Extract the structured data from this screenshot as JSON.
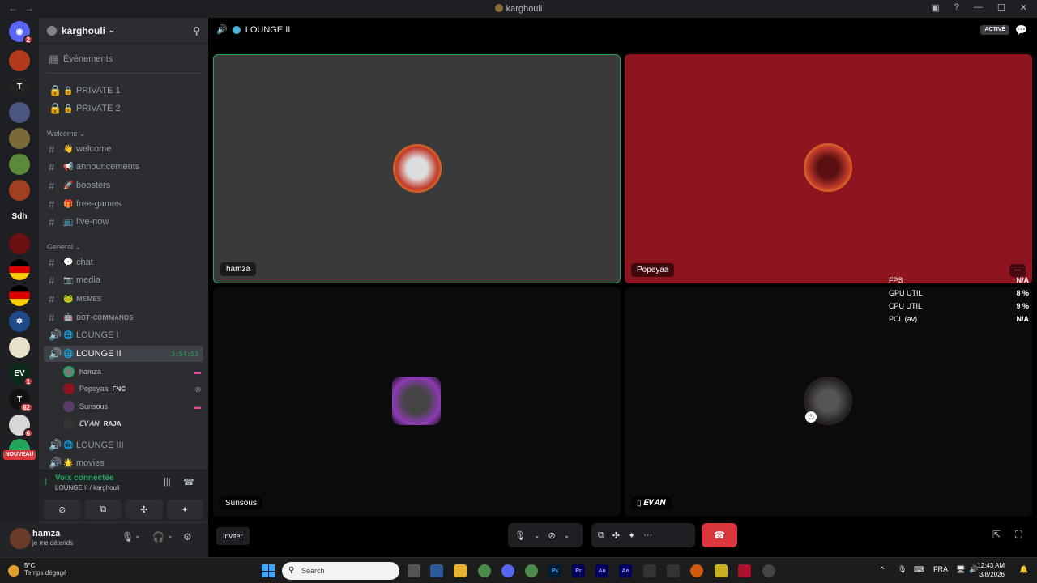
{
  "window": {
    "title": "karghouli"
  },
  "server": {
    "name": "karghouli"
  },
  "channels": {
    "events": "Événements",
    "private1": "PRIVATE 1",
    "private2": "PRIVATE 2",
    "cat_welcome": "Welcome",
    "welcome": "welcome",
    "announcements": "announcements",
    "boosters": "boosters",
    "free_games": "free-games",
    "live_now": "live-now",
    "cat_general": "General",
    "chat": "chat",
    "media": "media",
    "memes": "ᴍᴇᴍᴇs",
    "bot_commands": "ʙᴏᴛ-ᴄᴏᴍᴍᴀɴᴅs",
    "lounge1": "LOUNGE I",
    "lounge2": "LOUNGE II",
    "lounge2_timer": "3:54:53",
    "lounge3": "LOUNGE III",
    "movies": "movies"
  },
  "voice_members": [
    {
      "name": "hamza",
      "tag": ""
    },
    {
      "name": "Popeyaa",
      "tag": "FNC"
    },
    {
      "name": "Sunsous",
      "tag": ""
    },
    {
      "name": "𝑬𝑽𝑨𝑵",
      "tag": "RAJA"
    }
  ],
  "guild_badges": {
    "home": "2",
    "ev": "1",
    "g14": "82",
    "g15": "6"
  },
  "guild_labels": {
    "sdh": "Sdh",
    "nouveau": "NOUVEAU"
  },
  "voice_panel": {
    "status": "Voix connectée",
    "location": "LOUNGE II / karghouli"
  },
  "user": {
    "name": "hamza",
    "status": "je me détends"
  },
  "call": {
    "channel": "LOUNGE II",
    "active_badge": "ACTIVÉ",
    "invite": "Inviter",
    "tiles": [
      {
        "name": "hamza",
        "bg": "#3a3a3a",
        "speaking": true
      },
      {
        "name": "Popeyaa",
        "bg": "#8e1420",
        "speaking": false
      },
      {
        "name": "Sunsous",
        "bg": "#0b0b0b",
        "speaking": false
      },
      {
        "name": "𝑬𝑽𝑨𝑵",
        "bg": "#0b0b0b",
        "speaking": false
      }
    ]
  },
  "perf_overlay": {
    "fps_label": "FPS",
    "fps": "N/A",
    "gpu_label": "GPU UTIL",
    "gpu": "8 %",
    "cpu_label": "CPU UTIL",
    "cpu": "9 %",
    "pcl_label": "PCL (av)",
    "pcl": "N/A"
  },
  "taskbar": {
    "temp": "5°C",
    "weather": "Temps dégagé",
    "search": "Search",
    "lang": "FRA",
    "time": "12:43 AM",
    "date": "3/8/2026"
  },
  "colors": {
    "accent": "#5865f2",
    "online": "#23a55a",
    "danger": "#da373c"
  }
}
